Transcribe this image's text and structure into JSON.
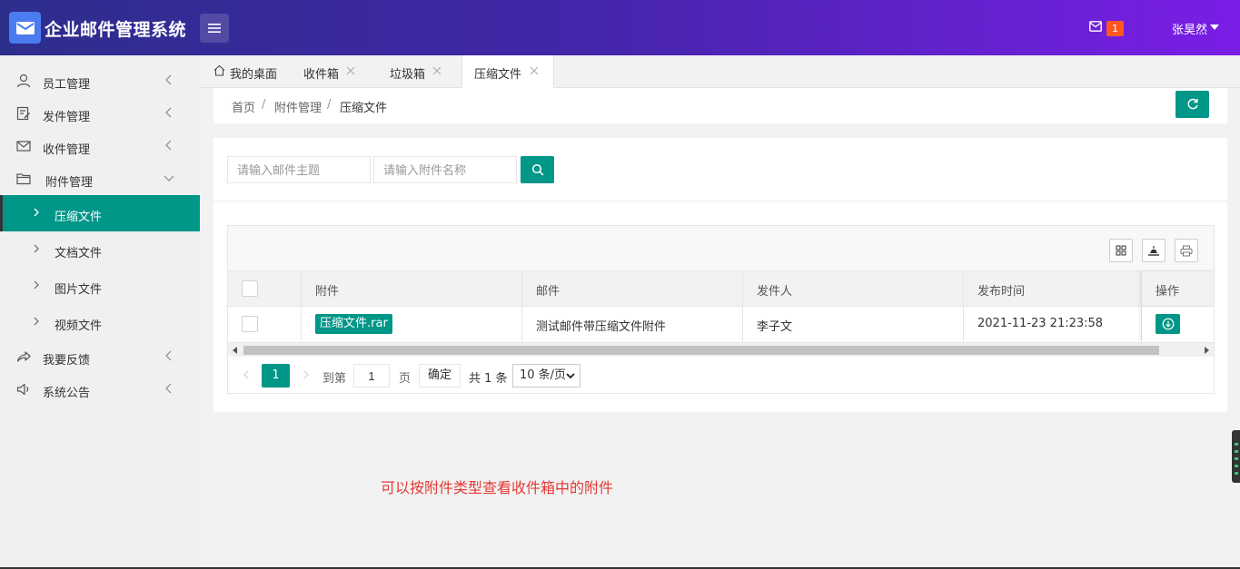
{
  "header": {
    "app_title": "企业邮件管理系统",
    "mail_badge": "1",
    "user_name": "张昊然"
  },
  "sidebar": {
    "items": [
      {
        "label": "员工管理",
        "icon": "user-icon"
      },
      {
        "label": "发件管理",
        "icon": "edit-icon"
      },
      {
        "label": "收件管理",
        "icon": "mail-icon"
      },
      {
        "label": "附件管理",
        "icon": "folder-icon",
        "expanded": true
      },
      {
        "label": "我要反馈",
        "icon": "share-icon"
      },
      {
        "label": "系统公告",
        "icon": "speaker-icon"
      }
    ],
    "sub_items": [
      {
        "label": "压缩文件",
        "active": true
      },
      {
        "label": "文档文件"
      },
      {
        "label": "图片文件"
      },
      {
        "label": "视频文件"
      }
    ]
  },
  "tabs": [
    {
      "label": "我的桌面",
      "icon": "home-icon"
    },
    {
      "label": "收件箱"
    },
    {
      "label": "垃圾箱"
    },
    {
      "label": "压缩文件",
      "active": true
    }
  ],
  "breadcrumb": [
    "首页",
    "附件管理",
    "压缩文件"
  ],
  "search": {
    "subject_placeholder": "请输入邮件主题",
    "attachment_placeholder": "请输入附件名称"
  },
  "table": {
    "columns": [
      "附件",
      "邮件",
      "发件人",
      "发布时间",
      "操作"
    ],
    "rows": [
      {
        "attachment": "压缩文件.rar",
        "mail": "测试邮件带压缩文件附件",
        "sender": "李子文",
        "time": "2021-11-23 21:23:58"
      }
    ]
  },
  "pager": {
    "current": "1",
    "goto_label": "到第",
    "goto_value": "1",
    "page_unit": "页",
    "confirm": "确定",
    "total": "共 1 条",
    "page_size": "10 条/页"
  },
  "note": "可以按附件类型查看收件箱中的附件",
  "colors": {
    "accent": "#009688",
    "badge": "#ff5722",
    "note": "#e53935"
  }
}
